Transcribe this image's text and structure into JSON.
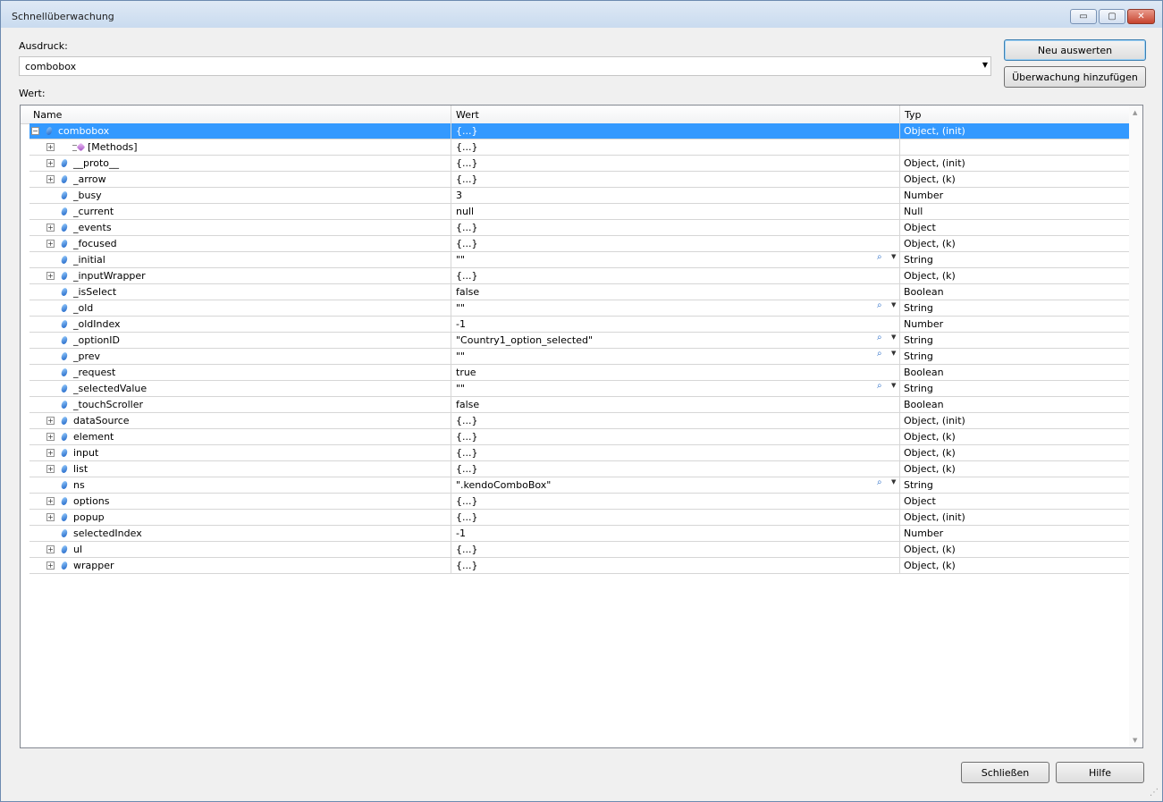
{
  "window": {
    "title": "Schnellüberwachung",
    "minimize_label": "▭",
    "maximize_label": "▢",
    "close_label": "✕"
  },
  "expression": {
    "label": "Ausdruck:",
    "value": "combobox"
  },
  "buttons": {
    "reevaluate": "Neu auswerten",
    "add_watch": "Überwachung hinzufügen",
    "close": "Schließen",
    "help": "Hilfe"
  },
  "value_section": {
    "label": "Wert:"
  },
  "grid": {
    "columns": [
      "Name",
      "Wert",
      "Typ"
    ],
    "rows": [
      {
        "name": "combobox",
        "value": "{...}",
        "type": "Object, (init)",
        "expand": "minus",
        "level": 0,
        "selected": true,
        "icon": "property-icon",
        "viewer": false
      },
      {
        "name": "[Methods]",
        "value": "{...}",
        "type": "",
        "expand": "plus",
        "level": 1,
        "selected": false,
        "icon": "methods-icon",
        "viewer": false
      },
      {
        "name": "__proto__",
        "value": "{...}",
        "type": "Object, (init)",
        "expand": "plus",
        "level": 1,
        "selected": false,
        "icon": "property-icon",
        "viewer": false
      },
      {
        "name": "_arrow",
        "value": "{...}",
        "type": "Object, (k)",
        "expand": "plus",
        "level": 1,
        "selected": false,
        "icon": "property-icon",
        "viewer": false
      },
      {
        "name": "_busy",
        "value": "3",
        "type": "Number",
        "expand": "",
        "level": 1,
        "selected": false,
        "icon": "property-icon",
        "viewer": false
      },
      {
        "name": "_current",
        "value": "null",
        "type": "Null",
        "expand": "",
        "level": 1,
        "selected": false,
        "icon": "property-icon",
        "viewer": false
      },
      {
        "name": "_events",
        "value": "{...}",
        "type": "Object",
        "expand": "plus",
        "level": 1,
        "selected": false,
        "icon": "property-icon",
        "viewer": false
      },
      {
        "name": "_focused",
        "value": "{...}",
        "type": "Object, (k)",
        "expand": "plus",
        "level": 1,
        "selected": false,
        "icon": "property-icon",
        "viewer": false
      },
      {
        "name": "_initial",
        "value": "\"\"",
        "type": "String",
        "expand": "",
        "level": 1,
        "selected": false,
        "icon": "property-icon",
        "viewer": true
      },
      {
        "name": "_inputWrapper",
        "value": "{...}",
        "type": "Object, (k)",
        "expand": "plus",
        "level": 1,
        "selected": false,
        "icon": "property-icon",
        "viewer": false
      },
      {
        "name": "_isSelect",
        "value": "false",
        "type": "Boolean",
        "expand": "",
        "level": 1,
        "selected": false,
        "icon": "property-icon",
        "viewer": false
      },
      {
        "name": "_old",
        "value": "\"\"",
        "type": "String",
        "expand": "",
        "level": 1,
        "selected": false,
        "icon": "property-icon",
        "viewer": true
      },
      {
        "name": "_oldIndex",
        "value": "-1",
        "type": "Number",
        "expand": "",
        "level": 1,
        "selected": false,
        "icon": "property-icon",
        "viewer": false
      },
      {
        "name": "_optionID",
        "value": "\"Country1_option_selected\"",
        "type": "String",
        "expand": "",
        "level": 1,
        "selected": false,
        "icon": "property-icon",
        "viewer": true
      },
      {
        "name": "_prev",
        "value": "\"\"",
        "type": "String",
        "expand": "",
        "level": 1,
        "selected": false,
        "icon": "property-icon",
        "viewer": true
      },
      {
        "name": "_request",
        "value": "true",
        "type": "Boolean",
        "expand": "",
        "level": 1,
        "selected": false,
        "icon": "property-icon",
        "viewer": false
      },
      {
        "name": "_selectedValue",
        "value": "\"\"",
        "type": "String",
        "expand": "",
        "level": 1,
        "selected": false,
        "icon": "property-icon",
        "viewer": true
      },
      {
        "name": "_touchScroller",
        "value": "false",
        "type": "Boolean",
        "expand": "",
        "level": 1,
        "selected": false,
        "icon": "property-icon",
        "viewer": false
      },
      {
        "name": "dataSource",
        "value": "{...}",
        "type": "Object, (init)",
        "expand": "plus",
        "level": 1,
        "selected": false,
        "icon": "property-icon",
        "viewer": false
      },
      {
        "name": "element",
        "value": "{...}",
        "type": "Object, (k)",
        "expand": "plus",
        "level": 1,
        "selected": false,
        "icon": "property-icon",
        "viewer": false
      },
      {
        "name": "input",
        "value": "{...}",
        "type": "Object, (k)",
        "expand": "plus",
        "level": 1,
        "selected": false,
        "icon": "property-icon",
        "viewer": false
      },
      {
        "name": "list",
        "value": "{...}",
        "type": "Object, (k)",
        "expand": "plus",
        "level": 1,
        "selected": false,
        "icon": "property-icon",
        "viewer": false
      },
      {
        "name": "ns",
        "value": "\".kendoComboBox\"",
        "type": "String",
        "expand": "",
        "level": 1,
        "selected": false,
        "icon": "property-icon",
        "viewer": true
      },
      {
        "name": "options",
        "value": "{...}",
        "type": "Object",
        "expand": "plus",
        "level": 1,
        "selected": false,
        "icon": "property-icon",
        "viewer": false
      },
      {
        "name": "popup",
        "value": "{...}",
        "type": "Object, (init)",
        "expand": "plus",
        "level": 1,
        "selected": false,
        "icon": "property-icon",
        "viewer": false
      },
      {
        "name": "selectedIndex",
        "value": "-1",
        "type": "Number",
        "expand": "",
        "level": 1,
        "selected": false,
        "icon": "property-icon",
        "viewer": false
      },
      {
        "name": "ul",
        "value": "{...}",
        "type": "Object, (k)",
        "expand": "plus",
        "level": 1,
        "selected": false,
        "icon": "property-icon",
        "viewer": false
      },
      {
        "name": "wrapper",
        "value": "{...}",
        "type": "Object, (k)",
        "expand": "plus",
        "level": 1,
        "selected": false,
        "icon": "property-icon",
        "viewer": false
      }
    ]
  }
}
